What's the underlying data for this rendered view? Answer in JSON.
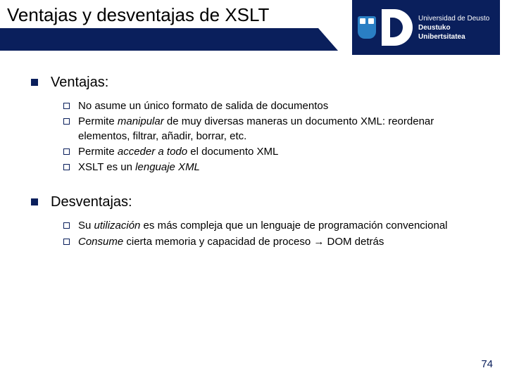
{
  "header": {
    "title": "Ventajas y desventajas de XSLT",
    "logo": {
      "line1": "Universidad de Deusto",
      "line2": "Deustuko Unibertsitatea"
    }
  },
  "sections": [
    {
      "title": "Ventajas:",
      "items": [
        {
          "html": "No asume un único formato de salida de documentos"
        },
        {
          "html": "Permite <em>manipular</em> de muy diversas maneras un documento XML: reordenar elementos, filtrar, añadir, borrar, etc."
        },
        {
          "html": "Permite <em>acceder a todo</em> el documento XML"
        },
        {
          "html": "XSLT es un <em>lenguaje XML</em>"
        }
      ]
    },
    {
      "title": "Desventajas:",
      "items": [
        {
          "html": "Su <em>utilización</em> es más compleja que un lenguaje de programación convencional"
        },
        {
          "html": "<em>Consume</em> cierta memoria y capacidad de proceso <span class=\"arrow-glyph\">&#8594;</span> DOM detrás"
        }
      ]
    }
  ],
  "page_number": "74"
}
